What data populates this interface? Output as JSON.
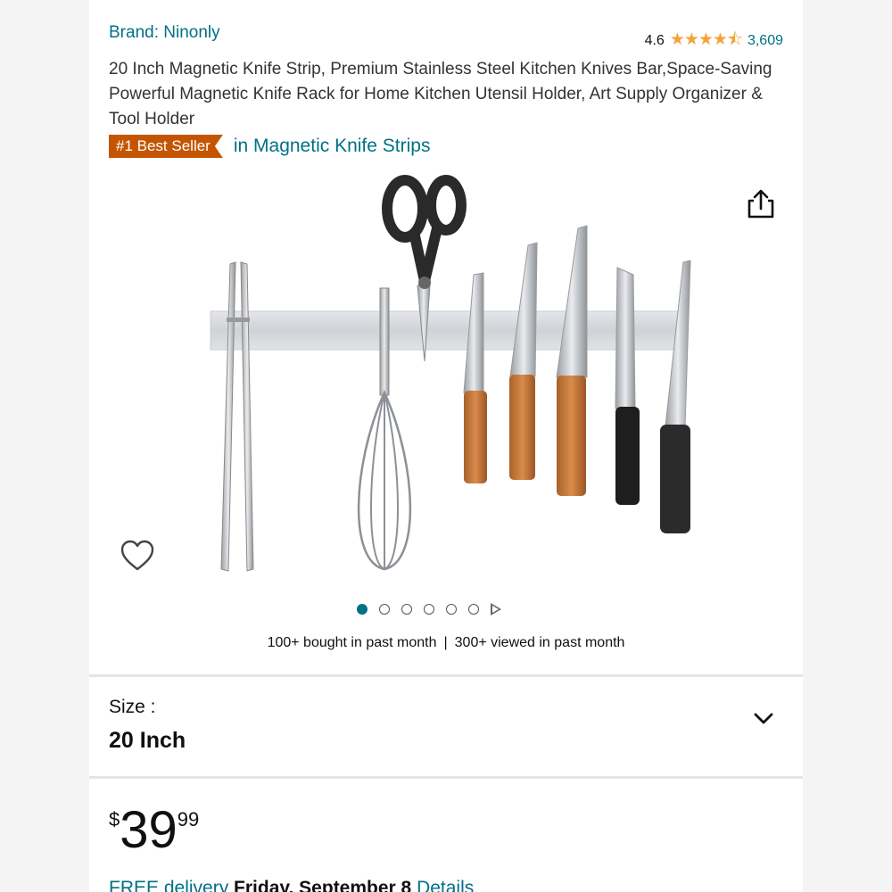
{
  "brand": "Brand: Ninonly",
  "rating": {
    "score": "4.6",
    "stars": "★★★★⯪",
    "count": "3,609"
  },
  "title": "20 Inch Magnetic Knife Strip, Premium Stainless Steel Kitchen Knives Bar,Space-Saving Powerful Magnetic Knife Rack for Home Kitchen Utensil Holder, Art Supply Organizer & Tool Holder",
  "badge": "#1 Best Seller",
  "category": "in Magnetic Knife Strips",
  "carousel": {
    "count": 6,
    "active_index": 0
  },
  "activity": {
    "bought": "100+ bought in past month",
    "separator": "|",
    "viewed": "300+ viewed in past month"
  },
  "size": {
    "label": "Size :",
    "value": "20 Inch"
  },
  "price": {
    "symbol": "$",
    "whole": "39",
    "fraction": "99"
  },
  "delivery": {
    "free": "FREE delivery",
    "date": "Friday, September 8",
    "details": "Details"
  },
  "icons": {
    "share": "share-icon",
    "wishlist": "heart-icon",
    "dropdown": "chevron-down-icon"
  },
  "colors": {
    "link": "#007185",
    "badge": "#c45500",
    "star": "#f2a33a"
  }
}
